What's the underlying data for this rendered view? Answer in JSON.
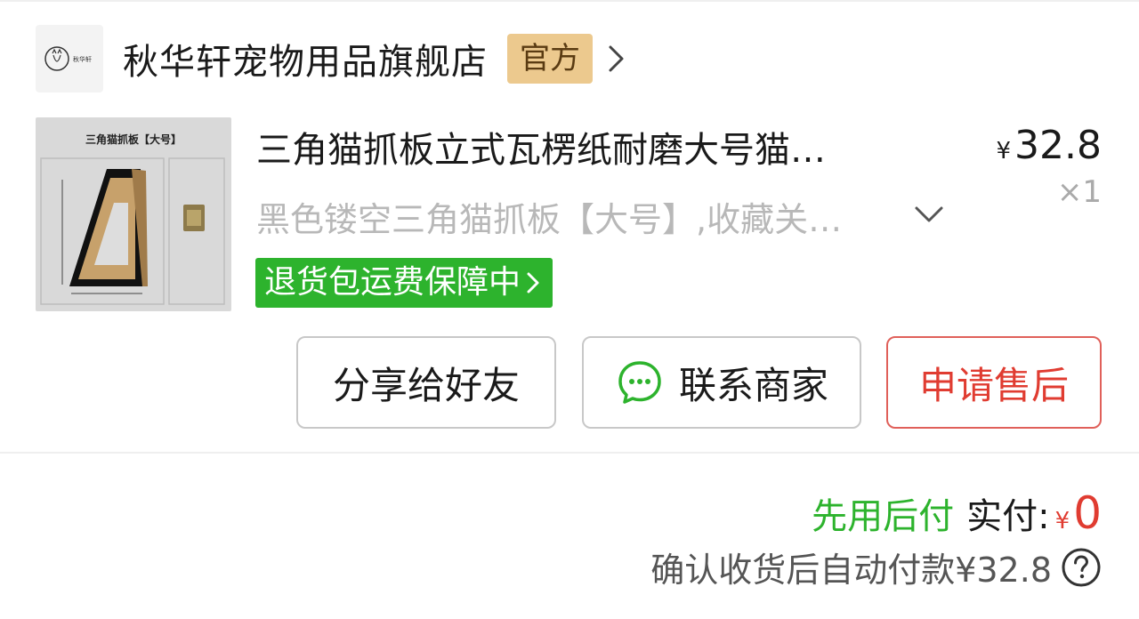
{
  "store": {
    "logo_icon": "cat-logo-icon",
    "logo_text": "秋华轩",
    "name": "秋华轩宠物用品旗舰店",
    "badge": "官方"
  },
  "product": {
    "thumbnail_caption": "三角猫抓板【大号】",
    "title": "三角猫抓板立式瓦楞纸耐磨大号猫…",
    "spec": "黑色镂空三角猫抓板【大号】,收藏关…",
    "price_currency": "¥",
    "price": "32.8",
    "quantity": "×1",
    "guarantee": "退货包运费保障中"
  },
  "actions": {
    "share_label": "分享给好友",
    "contact_label": "联系商家",
    "aftersale_label": "申请售后"
  },
  "payment": {
    "bnpl_label": "先用后付",
    "paid_label": "实付:",
    "paid_currency": "¥",
    "paid_amount": "0",
    "auto_pay_note": "确认收货后自动付款¥32.8"
  },
  "colors": {
    "accent_green": "#2db32d",
    "accent_red": "#e03c31",
    "badge_gold": "#ecc98e"
  }
}
